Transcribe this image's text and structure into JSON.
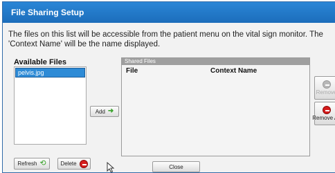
{
  "window": {
    "title": "File Sharing Setup"
  },
  "description": "The files on this list will be accessible from the patient menu on the vital sign monitor. The 'Context Name' will be the name displayed.",
  "available_files": {
    "label": "Available Files",
    "items": [
      "pelvis.jpg"
    ]
  },
  "shared_files": {
    "header": "Shared Files",
    "columns": [
      "File",
      "Context Name"
    ],
    "rows": []
  },
  "buttons": {
    "add": "Add",
    "remove": "Remove",
    "remove_all": "Remove All",
    "refresh": "Refresh",
    "delete": "Delete",
    "close": "Close"
  },
  "icons": {
    "add": "arrow-right-icon",
    "remove": "minus-circle-icon",
    "remove_all": "minus-circle-icon",
    "refresh": "refresh-icon",
    "delete": "minus-circle-icon"
  },
  "colors": {
    "title_bar": "#1f78c8",
    "selection": "#2e8bd6",
    "delete_red": "#d51c1c",
    "refresh_green": "#3aa32c"
  }
}
